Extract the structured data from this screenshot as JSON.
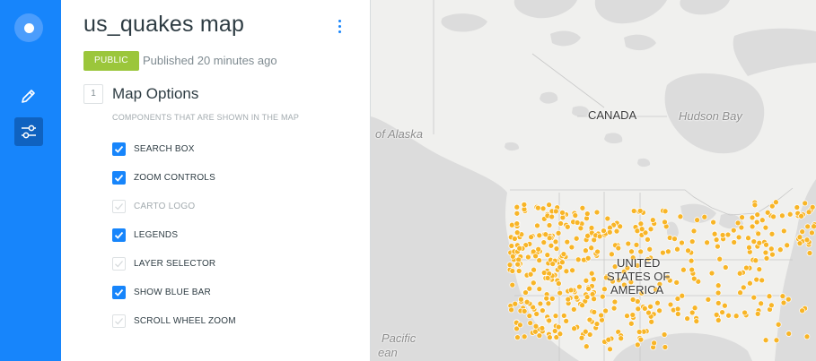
{
  "sidebar": {
    "items": [
      {
        "icon": "home-dot-icon"
      },
      {
        "icon": "pencil-icon"
      },
      {
        "icon": "sliders-icon"
      }
    ],
    "accent": "#1785fb"
  },
  "header": {
    "title": "us_quakes map",
    "badge": "PUBLIC",
    "published": "Published 20 minutes ago"
  },
  "section": {
    "number": "1",
    "title": "Map Options",
    "subtitle": "COMPONENTS THAT ARE SHOWN IN THE MAP",
    "options": [
      {
        "label": "SEARCH BOX",
        "checked": true,
        "enabled": true
      },
      {
        "label": "ZOOM CONTROLS",
        "checked": true,
        "enabled": true
      },
      {
        "label": "CARTO LOGO",
        "checked": false,
        "enabled": false
      },
      {
        "label": "LEGENDS",
        "checked": true,
        "enabled": true
      },
      {
        "label": "LAYER SELECTOR",
        "checked": false,
        "enabled": true
      },
      {
        "label": "SHOW BLUE BAR",
        "checked": true,
        "enabled": true
      },
      {
        "label": "SCROLL WHEEL ZOOM",
        "checked": false,
        "enabled": true
      }
    ]
  },
  "map": {
    "labels": {
      "canada": "CANADA",
      "hudson": "Hudson Bay",
      "alaska": "of Alaska",
      "usa1": "UNITED",
      "usa2": "STATES OF",
      "usa3": "AMERICA",
      "pacific1": "Pacific",
      "pacific2": "ean"
    },
    "point_color": "#f8b527"
  }
}
